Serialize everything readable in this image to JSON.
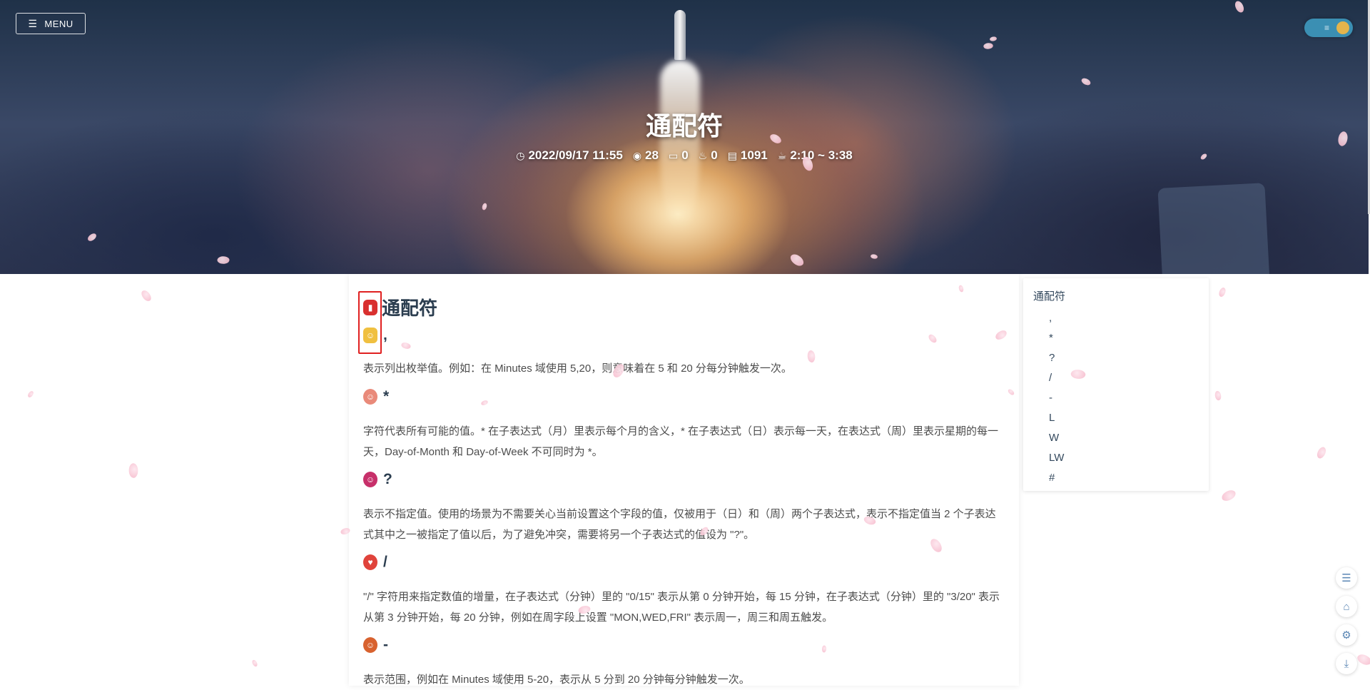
{
  "header": {
    "menu_label": "MENU",
    "menu_icon": "hamburger-icon",
    "theme_toggle_icon": "theme-toggle-icon"
  },
  "post": {
    "title": "通配符",
    "meta": {
      "date": "2022/09/17 11:55",
      "views": "28",
      "comments": "0",
      "likes": "0",
      "words": "1091",
      "read_time": "2:10 ~ 3:38"
    }
  },
  "article": {
    "heading": "通配符",
    "sections": [
      {
        "title": ",",
        "text": "表示列出枚举值。例如：在 Minutes 域使用 5,20，则意味着在 5 和 20 分每分钟触发一次。"
      },
      {
        "title": "*",
        "text": "字符代表所有可能的值。* 在子表达式（月）里表示每个月的含义，* 在子表达式（日）表示每一天，在表达式（周）里表示星期的每一天，Day-of-Month 和 Day-of-Week 不可同时为 *。"
      },
      {
        "title": "?",
        "text": "表示不指定值。使用的场景为不需要关心当前设置这个字段的值，仅被用于（日）和（周）两个子表达式，表示不指定值当 2 个子表达式其中之一被指定了值以后，为了避免冲突，需要将另一个子表达式的值设为 \"?\"。"
      },
      {
        "title": "/",
        "text": "\"/\" 字符用来指定数值的增量，在子表达式（分钟）里的 \"0/15\" 表示从第 0 分钟开始，每 15 分钟，在子表达式（分钟）里的 \"3/20\" 表示从第 3 分钟开始，每 20 分钟，例如在周字段上设置 \"MON,WED,FRI\" 表示周一，周三和周五触发。"
      },
      {
        "title": "-",
        "text": "表示范围，例如在 Minutes 域使用 5-20，表示从 5 分到 20 分钟每分钟触发一次。"
      }
    ]
  },
  "toc": {
    "title": "通配符",
    "items": [
      ",",
      "*",
      "?",
      "/",
      "-",
      "L",
      "W",
      "LW",
      "#"
    ]
  },
  "side_buttons": [
    {
      "name": "toc-toggle-icon",
      "glyph": "☰"
    },
    {
      "name": "home-icon",
      "glyph": "⌂"
    },
    {
      "name": "settings-icon",
      "glyph": "⚙"
    },
    {
      "name": "download-icon",
      "glyph": "⤓"
    }
  ],
  "colors": {
    "accent": "#3b8fb3",
    "highlight_box": "#e02020",
    "petal": "#f6b7c9"
  }
}
